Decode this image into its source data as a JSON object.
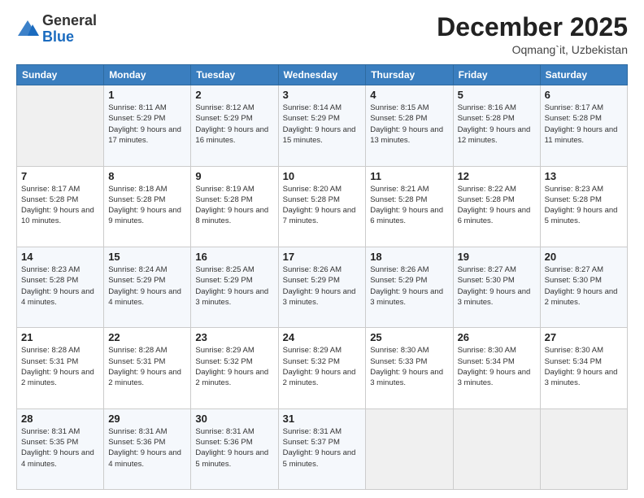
{
  "logo": {
    "general": "General",
    "blue": "Blue"
  },
  "header": {
    "month": "December 2025",
    "location": "Oqmang`it, Uzbekistan"
  },
  "weekdays": [
    "Sunday",
    "Monday",
    "Tuesday",
    "Wednesday",
    "Thursday",
    "Friday",
    "Saturday"
  ],
  "weeks": [
    [
      {
        "day": "",
        "sunrise": "",
        "sunset": "",
        "daylight": ""
      },
      {
        "day": "1",
        "sunrise": "Sunrise: 8:11 AM",
        "sunset": "Sunset: 5:29 PM",
        "daylight": "Daylight: 9 hours and 17 minutes."
      },
      {
        "day": "2",
        "sunrise": "Sunrise: 8:12 AM",
        "sunset": "Sunset: 5:29 PM",
        "daylight": "Daylight: 9 hours and 16 minutes."
      },
      {
        "day": "3",
        "sunrise": "Sunrise: 8:14 AM",
        "sunset": "Sunset: 5:29 PM",
        "daylight": "Daylight: 9 hours and 15 minutes."
      },
      {
        "day": "4",
        "sunrise": "Sunrise: 8:15 AM",
        "sunset": "Sunset: 5:28 PM",
        "daylight": "Daylight: 9 hours and 13 minutes."
      },
      {
        "day": "5",
        "sunrise": "Sunrise: 8:16 AM",
        "sunset": "Sunset: 5:28 PM",
        "daylight": "Daylight: 9 hours and 12 minutes."
      },
      {
        "day": "6",
        "sunrise": "Sunrise: 8:17 AM",
        "sunset": "Sunset: 5:28 PM",
        "daylight": "Daylight: 9 hours and 11 minutes."
      }
    ],
    [
      {
        "day": "7",
        "sunrise": "Sunrise: 8:17 AM",
        "sunset": "Sunset: 5:28 PM",
        "daylight": "Daylight: 9 hours and 10 minutes."
      },
      {
        "day": "8",
        "sunrise": "Sunrise: 8:18 AM",
        "sunset": "Sunset: 5:28 PM",
        "daylight": "Daylight: 9 hours and 9 minutes."
      },
      {
        "day": "9",
        "sunrise": "Sunrise: 8:19 AM",
        "sunset": "Sunset: 5:28 PM",
        "daylight": "Daylight: 9 hours and 8 minutes."
      },
      {
        "day": "10",
        "sunrise": "Sunrise: 8:20 AM",
        "sunset": "Sunset: 5:28 PM",
        "daylight": "Daylight: 9 hours and 7 minutes."
      },
      {
        "day": "11",
        "sunrise": "Sunrise: 8:21 AM",
        "sunset": "Sunset: 5:28 PM",
        "daylight": "Daylight: 9 hours and 6 minutes."
      },
      {
        "day": "12",
        "sunrise": "Sunrise: 8:22 AM",
        "sunset": "Sunset: 5:28 PM",
        "daylight": "Daylight: 9 hours and 6 minutes."
      },
      {
        "day": "13",
        "sunrise": "Sunrise: 8:23 AM",
        "sunset": "Sunset: 5:28 PM",
        "daylight": "Daylight: 9 hours and 5 minutes."
      }
    ],
    [
      {
        "day": "14",
        "sunrise": "Sunrise: 8:23 AM",
        "sunset": "Sunset: 5:28 PM",
        "daylight": "Daylight: 9 hours and 4 minutes."
      },
      {
        "day": "15",
        "sunrise": "Sunrise: 8:24 AM",
        "sunset": "Sunset: 5:29 PM",
        "daylight": "Daylight: 9 hours and 4 minutes."
      },
      {
        "day": "16",
        "sunrise": "Sunrise: 8:25 AM",
        "sunset": "Sunset: 5:29 PM",
        "daylight": "Daylight: 9 hours and 3 minutes."
      },
      {
        "day": "17",
        "sunrise": "Sunrise: 8:26 AM",
        "sunset": "Sunset: 5:29 PM",
        "daylight": "Daylight: 9 hours and 3 minutes."
      },
      {
        "day": "18",
        "sunrise": "Sunrise: 8:26 AM",
        "sunset": "Sunset: 5:29 PM",
        "daylight": "Daylight: 9 hours and 3 minutes."
      },
      {
        "day": "19",
        "sunrise": "Sunrise: 8:27 AM",
        "sunset": "Sunset: 5:30 PM",
        "daylight": "Daylight: 9 hours and 3 minutes."
      },
      {
        "day": "20",
        "sunrise": "Sunrise: 8:27 AM",
        "sunset": "Sunset: 5:30 PM",
        "daylight": "Daylight: 9 hours and 2 minutes."
      }
    ],
    [
      {
        "day": "21",
        "sunrise": "Sunrise: 8:28 AM",
        "sunset": "Sunset: 5:31 PM",
        "daylight": "Daylight: 9 hours and 2 minutes."
      },
      {
        "day": "22",
        "sunrise": "Sunrise: 8:28 AM",
        "sunset": "Sunset: 5:31 PM",
        "daylight": "Daylight: 9 hours and 2 minutes."
      },
      {
        "day": "23",
        "sunrise": "Sunrise: 8:29 AM",
        "sunset": "Sunset: 5:32 PM",
        "daylight": "Daylight: 9 hours and 2 minutes."
      },
      {
        "day": "24",
        "sunrise": "Sunrise: 8:29 AM",
        "sunset": "Sunset: 5:32 PM",
        "daylight": "Daylight: 9 hours and 2 minutes."
      },
      {
        "day": "25",
        "sunrise": "Sunrise: 8:30 AM",
        "sunset": "Sunset: 5:33 PM",
        "daylight": "Daylight: 9 hours and 3 minutes."
      },
      {
        "day": "26",
        "sunrise": "Sunrise: 8:30 AM",
        "sunset": "Sunset: 5:34 PM",
        "daylight": "Daylight: 9 hours and 3 minutes."
      },
      {
        "day": "27",
        "sunrise": "Sunrise: 8:30 AM",
        "sunset": "Sunset: 5:34 PM",
        "daylight": "Daylight: 9 hours and 3 minutes."
      }
    ],
    [
      {
        "day": "28",
        "sunrise": "Sunrise: 8:31 AM",
        "sunset": "Sunset: 5:35 PM",
        "daylight": "Daylight: 9 hours and 4 minutes."
      },
      {
        "day": "29",
        "sunrise": "Sunrise: 8:31 AM",
        "sunset": "Sunset: 5:36 PM",
        "daylight": "Daylight: 9 hours and 4 minutes."
      },
      {
        "day": "30",
        "sunrise": "Sunrise: 8:31 AM",
        "sunset": "Sunset: 5:36 PM",
        "daylight": "Daylight: 9 hours and 5 minutes."
      },
      {
        "day": "31",
        "sunrise": "Sunrise: 8:31 AM",
        "sunset": "Sunset: 5:37 PM",
        "daylight": "Daylight: 9 hours and 5 minutes."
      },
      {
        "day": "",
        "sunrise": "",
        "sunset": "",
        "daylight": ""
      },
      {
        "day": "",
        "sunrise": "",
        "sunset": "",
        "daylight": ""
      },
      {
        "day": "",
        "sunrise": "",
        "sunset": "",
        "daylight": ""
      }
    ]
  ]
}
